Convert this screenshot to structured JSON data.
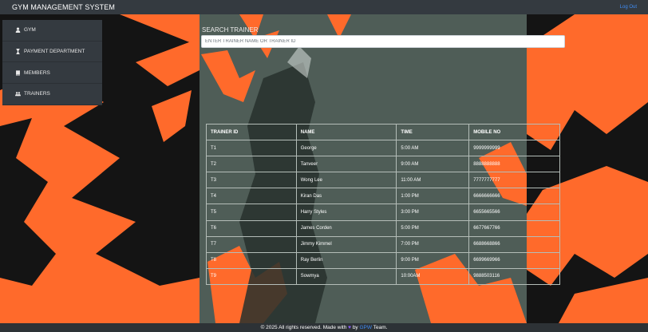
{
  "app": {
    "title": "GYM MANAGEMENT SYSTEM",
    "logout_label": "Log Out"
  },
  "sidebar": {
    "items": [
      {
        "label": "GYM",
        "icon": "user-icon"
      },
      {
        "label": "PAYMENT DEPARTMENT",
        "icon": "hourglass-icon"
      },
      {
        "label": "MEMBERS",
        "icon": "book-icon"
      },
      {
        "label": "TRAINERS",
        "icon": "users-icon"
      }
    ]
  },
  "search": {
    "label": "SEARCH TRAINER",
    "placeholder": "ENTER TRAINER NAME OR TRAINER ID",
    "value": ""
  },
  "table": {
    "headers": [
      "TRAINER ID",
      "NAME",
      "TIME",
      "MOBILE NO"
    ],
    "rows": [
      [
        "T1",
        "George",
        "5:00 AM",
        "9999999999"
      ],
      [
        "T2",
        "Tanveer",
        "9:00 AM",
        "8888888888"
      ],
      [
        "T3",
        "Wong Lee",
        "11:00 AM",
        "7777777777"
      ],
      [
        "T4",
        "Kiran Das",
        "1:00 PM",
        "6666666666"
      ],
      [
        "T5",
        "Harry Styles",
        "3:00 PM",
        "6655665566"
      ],
      [
        "T6",
        "James Corden",
        "5:00 PM",
        "6677667766"
      ],
      [
        "T7",
        "Jimmy Kimmel",
        "7:00 PM",
        "6688668866"
      ],
      [
        "T8",
        "Ray Berlin",
        "9:00 PM",
        "6699669966"
      ],
      [
        "T9",
        "Sowmya",
        "10:00AM",
        "9888503116"
      ]
    ]
  },
  "footer": {
    "prefix": "© 2025 All rights reserved. Made with",
    "by": "by",
    "team_link": "GPW",
    "suffix": "Team."
  },
  "colors": {
    "navbar": "#343a40",
    "accent_link": "#3f8df5",
    "background_orange": "#ff6a2b",
    "background_slate": "#4f5d57",
    "heart": "#8a5cf6"
  }
}
